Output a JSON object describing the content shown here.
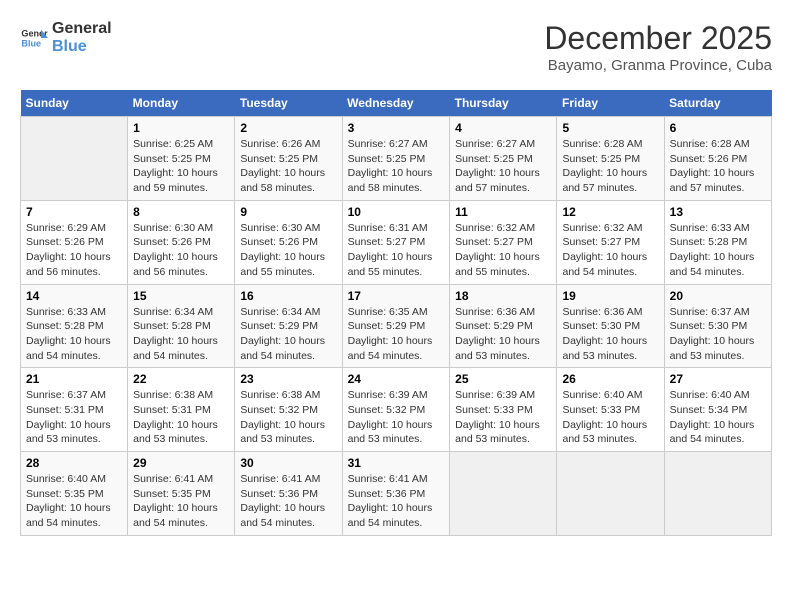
{
  "logo": {
    "text_general": "General",
    "text_blue": "Blue"
  },
  "title": "December 2025",
  "subtitle": "Bayamo, Granma Province, Cuba",
  "days_header": [
    "Sunday",
    "Monday",
    "Tuesday",
    "Wednesday",
    "Thursday",
    "Friday",
    "Saturday"
  ],
  "weeks": [
    [
      {
        "day": "",
        "info": ""
      },
      {
        "day": "1",
        "info": "Sunrise: 6:25 AM\nSunset: 5:25 PM\nDaylight: 10 hours\nand 59 minutes."
      },
      {
        "day": "2",
        "info": "Sunrise: 6:26 AM\nSunset: 5:25 PM\nDaylight: 10 hours\nand 58 minutes."
      },
      {
        "day": "3",
        "info": "Sunrise: 6:27 AM\nSunset: 5:25 PM\nDaylight: 10 hours\nand 58 minutes."
      },
      {
        "day": "4",
        "info": "Sunrise: 6:27 AM\nSunset: 5:25 PM\nDaylight: 10 hours\nand 57 minutes."
      },
      {
        "day": "5",
        "info": "Sunrise: 6:28 AM\nSunset: 5:25 PM\nDaylight: 10 hours\nand 57 minutes."
      },
      {
        "day": "6",
        "info": "Sunrise: 6:28 AM\nSunset: 5:26 PM\nDaylight: 10 hours\nand 57 minutes."
      }
    ],
    [
      {
        "day": "7",
        "info": "Sunrise: 6:29 AM\nSunset: 5:26 PM\nDaylight: 10 hours\nand 56 minutes."
      },
      {
        "day": "8",
        "info": "Sunrise: 6:30 AM\nSunset: 5:26 PM\nDaylight: 10 hours\nand 56 minutes."
      },
      {
        "day": "9",
        "info": "Sunrise: 6:30 AM\nSunset: 5:26 PM\nDaylight: 10 hours\nand 55 minutes."
      },
      {
        "day": "10",
        "info": "Sunrise: 6:31 AM\nSunset: 5:27 PM\nDaylight: 10 hours\nand 55 minutes."
      },
      {
        "day": "11",
        "info": "Sunrise: 6:32 AM\nSunset: 5:27 PM\nDaylight: 10 hours\nand 55 minutes."
      },
      {
        "day": "12",
        "info": "Sunrise: 6:32 AM\nSunset: 5:27 PM\nDaylight: 10 hours\nand 54 minutes."
      },
      {
        "day": "13",
        "info": "Sunrise: 6:33 AM\nSunset: 5:28 PM\nDaylight: 10 hours\nand 54 minutes."
      }
    ],
    [
      {
        "day": "14",
        "info": "Sunrise: 6:33 AM\nSunset: 5:28 PM\nDaylight: 10 hours\nand 54 minutes."
      },
      {
        "day": "15",
        "info": "Sunrise: 6:34 AM\nSunset: 5:28 PM\nDaylight: 10 hours\nand 54 minutes."
      },
      {
        "day": "16",
        "info": "Sunrise: 6:34 AM\nSunset: 5:29 PM\nDaylight: 10 hours\nand 54 minutes."
      },
      {
        "day": "17",
        "info": "Sunrise: 6:35 AM\nSunset: 5:29 PM\nDaylight: 10 hours\nand 54 minutes."
      },
      {
        "day": "18",
        "info": "Sunrise: 6:36 AM\nSunset: 5:29 PM\nDaylight: 10 hours\nand 53 minutes."
      },
      {
        "day": "19",
        "info": "Sunrise: 6:36 AM\nSunset: 5:30 PM\nDaylight: 10 hours\nand 53 minutes."
      },
      {
        "day": "20",
        "info": "Sunrise: 6:37 AM\nSunset: 5:30 PM\nDaylight: 10 hours\nand 53 minutes."
      }
    ],
    [
      {
        "day": "21",
        "info": "Sunrise: 6:37 AM\nSunset: 5:31 PM\nDaylight: 10 hours\nand 53 minutes."
      },
      {
        "day": "22",
        "info": "Sunrise: 6:38 AM\nSunset: 5:31 PM\nDaylight: 10 hours\nand 53 minutes."
      },
      {
        "day": "23",
        "info": "Sunrise: 6:38 AM\nSunset: 5:32 PM\nDaylight: 10 hours\nand 53 minutes."
      },
      {
        "day": "24",
        "info": "Sunrise: 6:39 AM\nSunset: 5:32 PM\nDaylight: 10 hours\nand 53 minutes."
      },
      {
        "day": "25",
        "info": "Sunrise: 6:39 AM\nSunset: 5:33 PM\nDaylight: 10 hours\nand 53 minutes."
      },
      {
        "day": "26",
        "info": "Sunrise: 6:40 AM\nSunset: 5:33 PM\nDaylight: 10 hours\nand 53 minutes."
      },
      {
        "day": "27",
        "info": "Sunrise: 6:40 AM\nSunset: 5:34 PM\nDaylight: 10 hours\nand 54 minutes."
      }
    ],
    [
      {
        "day": "28",
        "info": "Sunrise: 6:40 AM\nSunset: 5:35 PM\nDaylight: 10 hours\nand 54 minutes."
      },
      {
        "day": "29",
        "info": "Sunrise: 6:41 AM\nSunset: 5:35 PM\nDaylight: 10 hours\nand 54 minutes."
      },
      {
        "day": "30",
        "info": "Sunrise: 6:41 AM\nSunset: 5:36 PM\nDaylight: 10 hours\nand 54 minutes."
      },
      {
        "day": "31",
        "info": "Sunrise: 6:41 AM\nSunset: 5:36 PM\nDaylight: 10 hours\nand 54 minutes."
      },
      {
        "day": "",
        "info": ""
      },
      {
        "day": "",
        "info": ""
      },
      {
        "day": "",
        "info": ""
      }
    ]
  ]
}
